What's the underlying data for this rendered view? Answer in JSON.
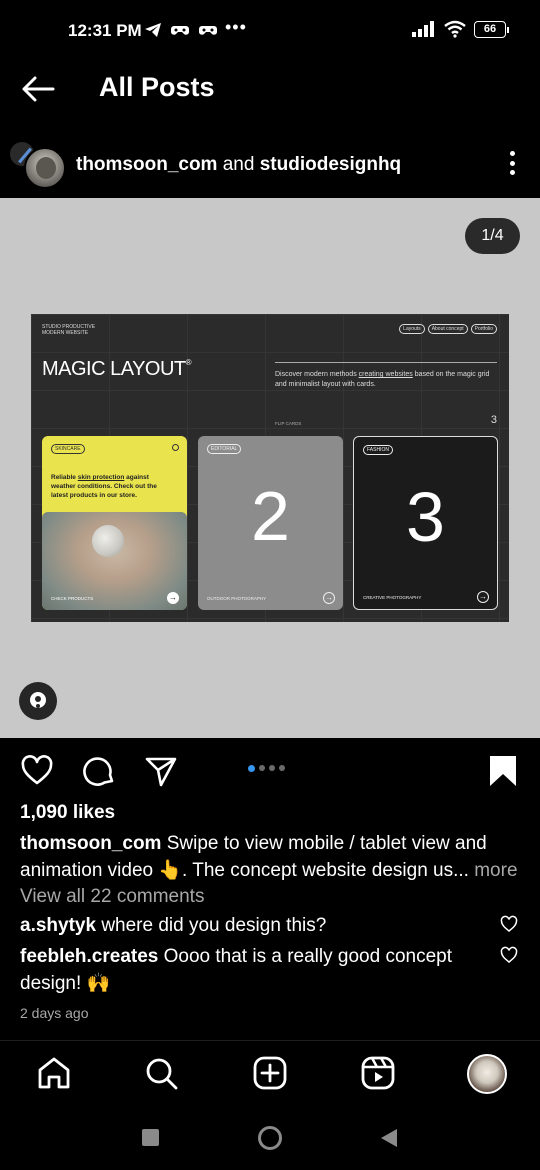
{
  "status_bar": {
    "time": "12:31 PM",
    "more": "•••",
    "battery": "66"
  },
  "header": {
    "title": "All Posts",
    "back_icon": "arrow-left-icon"
  },
  "post": {
    "author": "thomsoon_com",
    "joiner": "and",
    "coauthor": "studiodesignhq",
    "counter": "1/4",
    "mockup": {
      "logo_line1": "Studio productive",
      "logo_line2": "modern website",
      "nav": [
        "Layouts",
        "About concept",
        "Portfolio"
      ],
      "title": "MAGIC LAYOUT",
      "title_mark": "®",
      "desc_before": "Discover modern methods ",
      "desc_link": "creating websites",
      "desc_after": " based on the magic grid and minimalist layout with cards.",
      "flip_label": "FLIP CARDS",
      "flip_count": "3",
      "cards": [
        {
          "chip": "SKINCARE",
          "text_before": "Reliable ",
          "text_link": "skin protection",
          "text_after": " against weather conditions. Check out the latest products in our store.",
          "footer": "Check products",
          "arrow": "→"
        },
        {
          "chip": "EDITORIAL",
          "number": "2",
          "footer": "Outdoor photography",
          "arrow": "→"
        },
        {
          "chip": "FASHION",
          "number": "3",
          "footer": "Creative photography",
          "arrow": "→"
        }
      ]
    },
    "likes": "1,090 likes",
    "caption_user": "thomsoon_com",
    "caption_text": "Swipe to view mobile / tablet view and animation video 👆. The concept website design us...",
    "caption_more": "more",
    "view_comments": "View all 22 comments",
    "comments": [
      {
        "user": "a.shytyk",
        "text": "where did you design this?"
      },
      {
        "user": "feebleh.creates",
        "text": "Oooo that is a really good concept design! 🙌"
      }
    ],
    "date": "2 days ago",
    "carousel": {
      "total": 4,
      "active_index": 0
    }
  },
  "colors": {
    "background": "#000000",
    "image_bg": "#c8c8c8",
    "muted_text": "#a8a8a8",
    "active_dot": "#3797f0",
    "card1_yellow": "#e9e34e"
  },
  "icons": {
    "actions": [
      "heart-icon",
      "comment-icon",
      "share-icon",
      "bookmark-icon"
    ],
    "bottom_nav": [
      "home-icon",
      "search-icon",
      "create-icon",
      "reels-icon",
      "profile-avatar"
    ],
    "android": [
      "recents-icon",
      "home-circle-icon",
      "back-triangle-icon"
    ]
  }
}
